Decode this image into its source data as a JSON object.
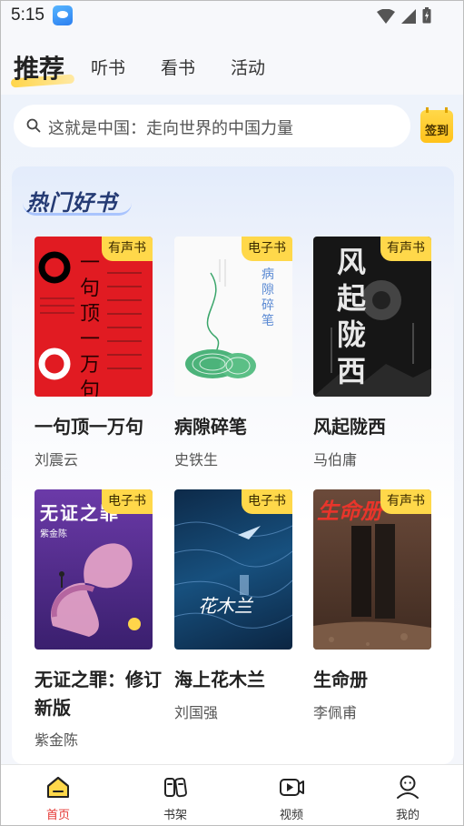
{
  "status_bar": {
    "time": "5:15"
  },
  "top_tabs": [
    {
      "label": "推荐",
      "active": true
    },
    {
      "label": "听书",
      "active": false
    },
    {
      "label": "看书",
      "active": false
    },
    {
      "label": "活动",
      "active": false
    }
  ],
  "search": {
    "placeholder": "这就是中国：走向世界的中国力量"
  },
  "checkin": {
    "label": "签到"
  },
  "hot_books": {
    "title": "热门好书",
    "books": [
      {
        "title": "一句顶一万句",
        "author": "刘震云",
        "badge": "有声书",
        "cover_text": "一句顶一万句"
      },
      {
        "title": "病隙碎笔",
        "author": "史铁生",
        "badge": "电子书",
        "cover_text": "病隙碎笔"
      },
      {
        "title": "风起陇西",
        "author": "马伯庸",
        "badge": "有声书",
        "cover_text": "风起陇西"
      },
      {
        "title": "无证之罪：修订新版",
        "author": "紫金陈",
        "badge": "电子书",
        "cover_text": "无证之罪"
      },
      {
        "title": "海上花木兰",
        "author": "刘国强",
        "badge": "电子书",
        "cover_text": "花木兰"
      },
      {
        "title": "生命册",
        "author": "李佩甫",
        "badge": "有声书",
        "cover_text": "生命册"
      }
    ]
  },
  "bottom_nav": [
    {
      "label": "首页",
      "icon": "home-icon",
      "active": true
    },
    {
      "label": "书架",
      "icon": "bookshelf-icon",
      "active": false
    },
    {
      "label": "视频",
      "icon": "video-icon",
      "active": false
    },
    {
      "label": "我的",
      "icon": "profile-icon",
      "active": false
    }
  ],
  "colors": {
    "accent": "#e53935",
    "badge": "#ffd84a",
    "title": "#253b74"
  }
}
